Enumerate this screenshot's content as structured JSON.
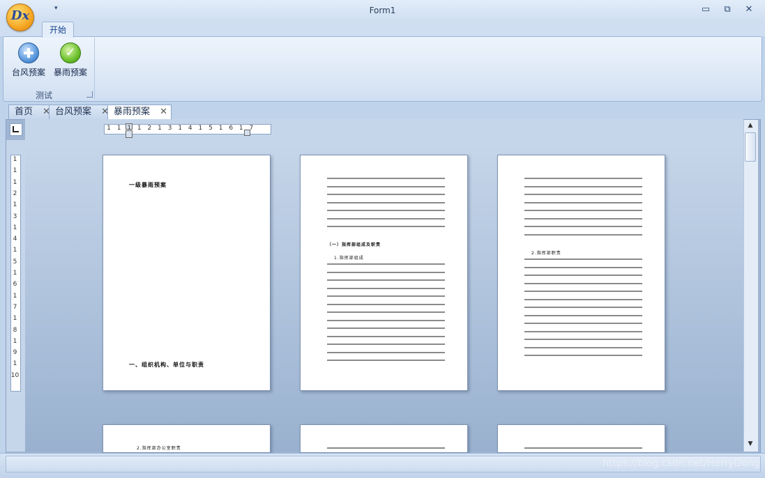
{
  "window": {
    "title": "Form1",
    "logo_text": "Dx",
    "qat_glyph": "▾",
    "controls": {
      "minimize": "▭",
      "restore": "⧉",
      "close": "✕"
    }
  },
  "ribbon": {
    "tab": "开始",
    "group": {
      "label": "测试",
      "buttons": [
        {
          "label": "台风预案",
          "icon": "add-circle-icon"
        },
        {
          "label": "暴雨预案",
          "icon": "check-circle-icon"
        }
      ]
    }
  },
  "doc_tabs": [
    {
      "label": "首页",
      "close": "✕"
    },
    {
      "label": "台风预案",
      "close": "✕"
    },
    {
      "label": "暴雨预案",
      "close": "✕",
      "active": true
    }
  ],
  "ruler": {
    "h_ticks": [
      "1",
      "1",
      "1",
      "1",
      "2",
      "1",
      "3",
      "1",
      "4",
      "1",
      "5",
      "1",
      "6",
      "1",
      "7"
    ],
    "v_ticks": [
      "1",
      "1",
      "1",
      "2",
      "1",
      "3",
      "1",
      "4",
      "1",
      "5",
      "1",
      "6",
      "1",
      "7",
      "1",
      "8",
      "1",
      "9",
      "1",
      "10"
    ]
  },
  "pages": {
    "page1_heading": "一级暴雨预案",
    "page1_footer": "一、组织机构、单位与职责",
    "page2_section": "（一）指挥部组成及职责",
    "page2_sub": "1.指挥部组成",
    "page3_sub": "2.指挥部职责",
    "page4_heading": "2.指挥部办公室职责"
  },
  "scrollbar": {
    "up": "▲",
    "down": "▼"
  },
  "watermark": "https://blog.csdn.net/HerryDong"
}
